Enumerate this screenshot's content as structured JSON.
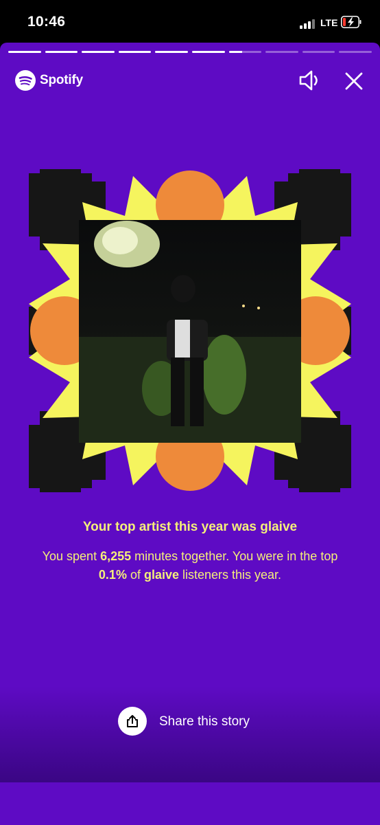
{
  "status_bar": {
    "time": "10:46",
    "network": "LTE",
    "battery_state": "low-charging",
    "signal_icon": "signal-icon",
    "battery_icon": "battery-charging-icon"
  },
  "story": {
    "progress": {
      "total_segments": 10,
      "completed_segments": 6,
      "current_segment_fraction": 0.4
    },
    "brand": {
      "name": "Spotify",
      "icon": "spotify-logo-icon"
    },
    "controls": {
      "sound_icon": "speaker-icon",
      "close_icon": "close-icon"
    },
    "headline": "Your top artist this year was glaive",
    "description": {
      "part1": "You spent ",
      "minutes": "6,255",
      "part2": " minutes together. You were in the top ",
      "percent": "0.1%",
      "part3": " of ",
      "artist": "glaive",
      "part4": " listeners this year."
    },
    "share": {
      "label": "Share this story",
      "icon": "share-icon"
    }
  },
  "colors": {
    "background": "#5e0bc4",
    "accent_yellow": "#f4ef7a",
    "burst_yellow": "#f5f45e",
    "circle_orange": "#ee8a3a",
    "block_black": "#161616"
  }
}
